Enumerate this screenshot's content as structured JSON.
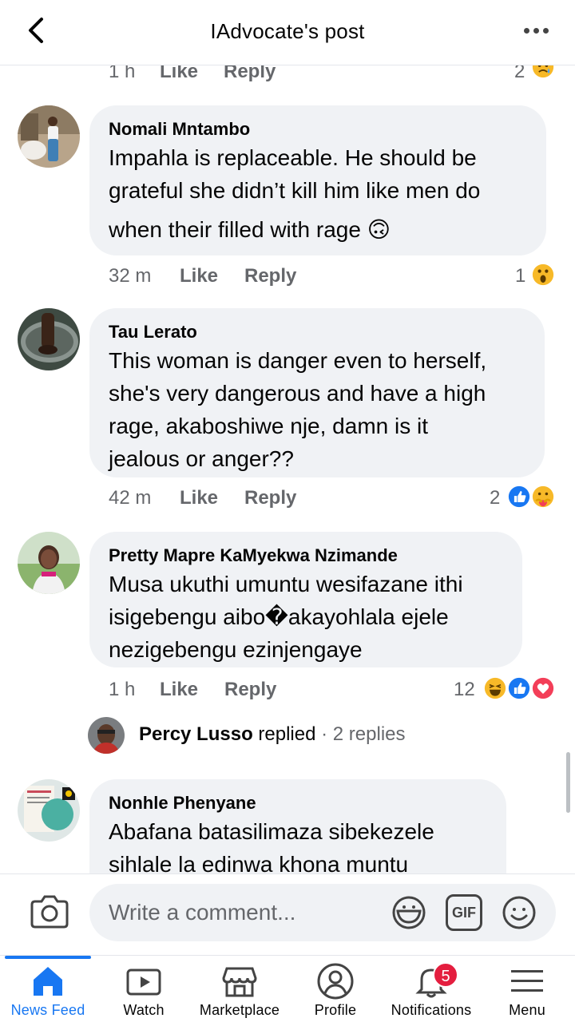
{
  "header": {
    "title": "IAdvocate's post"
  },
  "prev_comment": {
    "time": "1 h",
    "like": "Like",
    "reply": "Reply",
    "count": "2"
  },
  "comments": [
    {
      "name": "Nomali Mntambo",
      "text_lines": [
        "Impahla is replaceable. He should be",
        "grateful she didn’t kill him like men do",
        "when their filled with rage 🙃"
      ],
      "time": "32 m",
      "like": "Like",
      "reply": "Reply",
      "reaction_count": "1",
      "reactions": [
        "wow"
      ]
    },
    {
      "name": "Tau Lerato",
      "text_lines": [
        "This woman is danger even to herself,",
        "she's very dangerous and have a high",
        "rage, akaboshiwe nje, damn is it",
        "jealous or anger??"
      ],
      "time": "42 m",
      "like": "Like",
      "reply": "Reply",
      "reaction_count": "2",
      "reactions": [
        "like",
        "care"
      ]
    },
    {
      "name": "Pretty Mapre KaMyekwa Nzimande",
      "text_lines": [
        "Musa ukuthi umuntu wesifazane ithi",
        "isigebengu aibo�akayohlala ejele",
        "nezigebengu ezinjengaye"
      ],
      "time": "1 h",
      "like": "Like",
      "reply": "Reply",
      "reaction_count": "12",
      "reactions": [
        "haha",
        "like",
        "love"
      ],
      "replies": {
        "name": "Percy Lusso",
        "action": " replied",
        "sep": " · ",
        "count": "2 replies"
      }
    },
    {
      "name": "Nonhle Phenyane",
      "text_lines": [
        "Abafana batasilimaza sibekezele",
        "sihlale la edinwa khona muntu"
      ]
    }
  ],
  "composer": {
    "placeholder": "Write a comment...",
    "gif_label": "GIF"
  },
  "tabs": [
    {
      "label": "News Feed",
      "icon": "home-icon",
      "active": true
    },
    {
      "label": "Watch",
      "icon": "watch-icon"
    },
    {
      "label": "Marketplace",
      "icon": "marketplace-icon"
    },
    {
      "label": "Profile",
      "icon": "profile-icon"
    },
    {
      "label": "Notifications",
      "icon": "bell-icon",
      "badge": "5"
    },
    {
      "label": "Menu",
      "icon": "menu-icon"
    }
  ],
  "colors": {
    "accent": "#1877f2",
    "bubble": "#f0f2f5",
    "muted": "#65676b",
    "badge": "#e41e3f"
  }
}
